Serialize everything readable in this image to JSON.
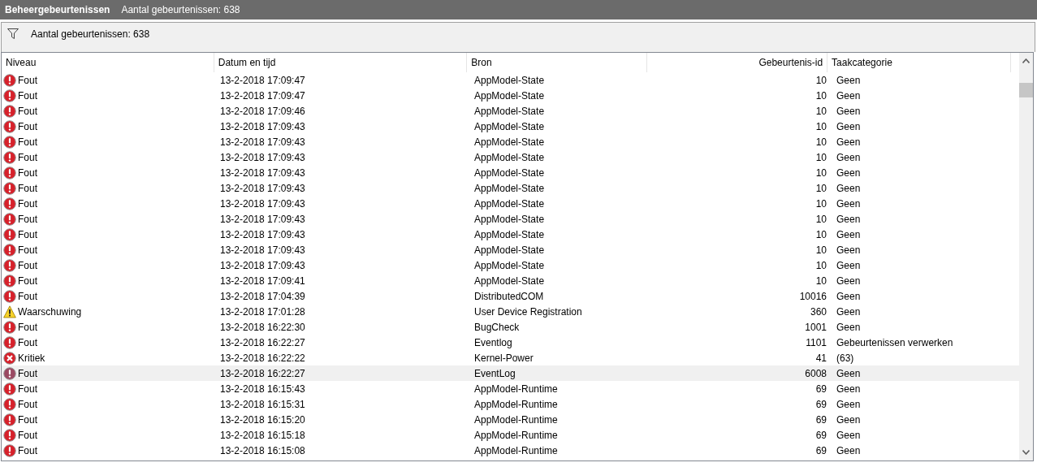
{
  "title_bar": {
    "title": "Beheergebeurtenissen",
    "subtitle": "Aantal gebeurtenissen: 638"
  },
  "filter_bar": {
    "text": "Aantal gebeurtenissen: 638"
  },
  "table": {
    "columns": [
      "Niveau",
      "Datum en tijd",
      "Bron",
      "Gebeurtenis-id",
      "Taakcategorie"
    ],
    "rows": [
      {
        "kind": "error",
        "level": "Fout",
        "date": "13-2-2018 17:09:47",
        "source": "AppModel-State",
        "id": "10",
        "category": "Geen",
        "selected": false
      },
      {
        "kind": "error",
        "level": "Fout",
        "date": "13-2-2018 17:09:47",
        "source": "AppModel-State",
        "id": "10",
        "category": "Geen",
        "selected": false
      },
      {
        "kind": "error",
        "level": "Fout",
        "date": "13-2-2018 17:09:46",
        "source": "AppModel-State",
        "id": "10",
        "category": "Geen",
        "selected": false
      },
      {
        "kind": "error",
        "level": "Fout",
        "date": "13-2-2018 17:09:43",
        "source": "AppModel-State",
        "id": "10",
        "category": "Geen",
        "selected": false
      },
      {
        "kind": "error",
        "level": "Fout",
        "date": "13-2-2018 17:09:43",
        "source": "AppModel-State",
        "id": "10",
        "category": "Geen",
        "selected": false
      },
      {
        "kind": "error",
        "level": "Fout",
        "date": "13-2-2018 17:09:43",
        "source": "AppModel-State",
        "id": "10",
        "category": "Geen",
        "selected": false
      },
      {
        "kind": "error",
        "level": "Fout",
        "date": "13-2-2018 17:09:43",
        "source": "AppModel-State",
        "id": "10",
        "category": "Geen",
        "selected": false
      },
      {
        "kind": "error",
        "level": "Fout",
        "date": "13-2-2018 17:09:43",
        "source": "AppModel-State",
        "id": "10",
        "category": "Geen",
        "selected": false
      },
      {
        "kind": "error",
        "level": "Fout",
        "date": "13-2-2018 17:09:43",
        "source": "AppModel-State",
        "id": "10",
        "category": "Geen",
        "selected": false
      },
      {
        "kind": "error",
        "level": "Fout",
        "date": "13-2-2018 17:09:43",
        "source": "AppModel-State",
        "id": "10",
        "category": "Geen",
        "selected": false
      },
      {
        "kind": "error",
        "level": "Fout",
        "date": "13-2-2018 17:09:43",
        "source": "AppModel-State",
        "id": "10",
        "category": "Geen",
        "selected": false
      },
      {
        "kind": "error",
        "level": "Fout",
        "date": "13-2-2018 17:09:43",
        "source": "AppModel-State",
        "id": "10",
        "category": "Geen",
        "selected": false
      },
      {
        "kind": "error",
        "level": "Fout",
        "date": "13-2-2018 17:09:43",
        "source": "AppModel-State",
        "id": "10",
        "category": "Geen",
        "selected": false
      },
      {
        "kind": "error",
        "level": "Fout",
        "date": "13-2-2018 17:09:41",
        "source": "AppModel-State",
        "id": "10",
        "category": "Geen",
        "selected": false
      },
      {
        "kind": "error",
        "level": "Fout",
        "date": "13-2-2018 17:04:39",
        "source": "DistributedCOM",
        "id": "10016",
        "category": "Geen",
        "selected": false
      },
      {
        "kind": "warning",
        "level": "Waarschuwing",
        "date": "13-2-2018 17:01:28",
        "source": "User Device Registration",
        "id": "360",
        "category": "Geen",
        "selected": false
      },
      {
        "kind": "error",
        "level": "Fout",
        "date": "13-2-2018 16:22:30",
        "source": "BugCheck",
        "id": "1001",
        "category": "Geen",
        "selected": false
      },
      {
        "kind": "error",
        "level": "Fout",
        "date": "13-2-2018 16:22:27",
        "source": "Eventlog",
        "id": "1101",
        "category": "Gebeurtenissen verwerken",
        "selected": false
      },
      {
        "kind": "critical",
        "level": "Kritiek",
        "date": "13-2-2018 16:22:22",
        "source": "Kernel-Power",
        "id": "41",
        "category": "(63)",
        "selected": false
      },
      {
        "kind": "error",
        "level": "Fout",
        "date": "13-2-2018 16:22:27",
        "source": "EventLog",
        "id": "6008",
        "category": "Geen",
        "selected": true
      },
      {
        "kind": "error",
        "level": "Fout",
        "date": "13-2-2018 16:15:43",
        "source": "AppModel-Runtime",
        "id": "69",
        "category": "Geen",
        "selected": false
      },
      {
        "kind": "error",
        "level": "Fout",
        "date": "13-2-2018 16:15:31",
        "source": "AppModel-Runtime",
        "id": "69",
        "category": "Geen",
        "selected": false
      },
      {
        "kind": "error",
        "level": "Fout",
        "date": "13-2-2018 16:15:20",
        "source": "AppModel-Runtime",
        "id": "69",
        "category": "Geen",
        "selected": false
      },
      {
        "kind": "error",
        "level": "Fout",
        "date": "13-2-2018 16:15:18",
        "source": "AppModel-Runtime",
        "id": "69",
        "category": "Geen",
        "selected": false
      },
      {
        "kind": "error",
        "level": "Fout",
        "date": "13-2-2018 16:15:08",
        "source": "AppModel-Runtime",
        "id": "69",
        "category": "Geen",
        "selected": false
      }
    ]
  }
}
